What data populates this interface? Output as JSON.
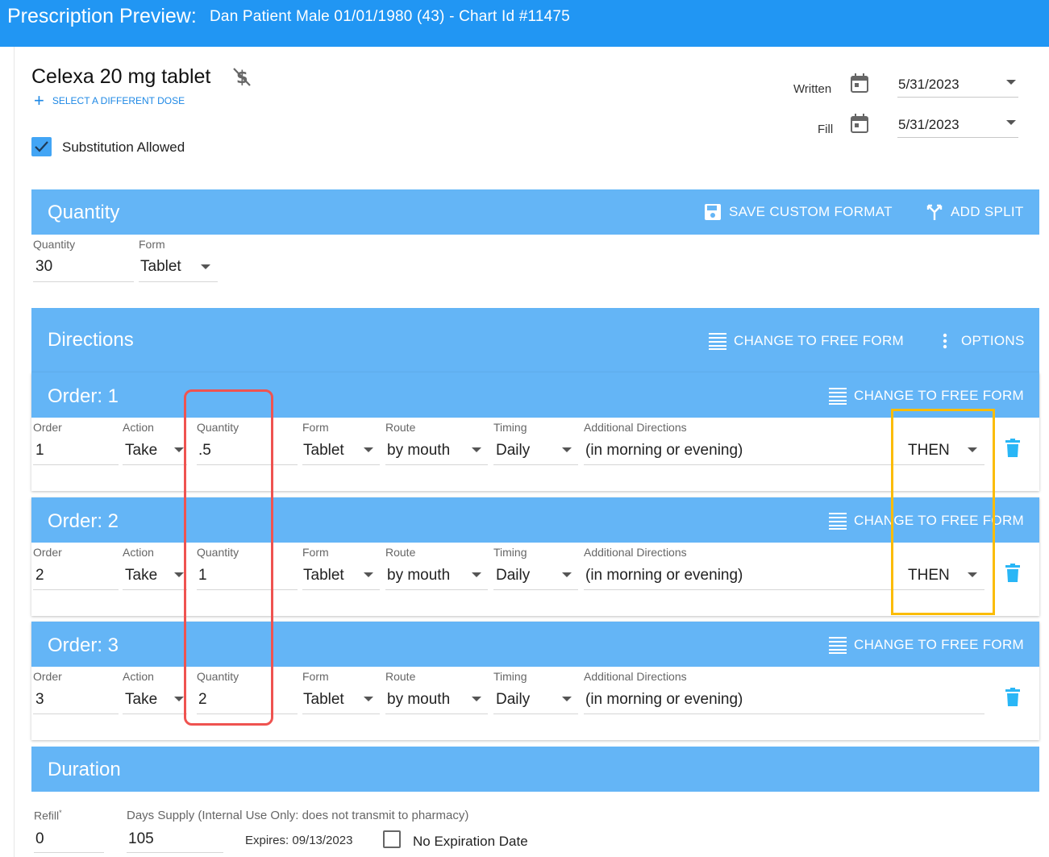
{
  "header": {
    "title": "Prescription Preview:",
    "patient": "Dan Patient Male 01/01/1980 (43) - Chart Id #11475"
  },
  "drug": {
    "name": "Celexa 20 mg tablet",
    "select_dose_label": "SELECT A DIFFERENT DOSE",
    "substitution_label": "Substitution Allowed",
    "substitution_checked": true
  },
  "dates": {
    "written_label": "Written",
    "written_value": "5/31/2023",
    "fill_label": "Fill",
    "fill_value": "5/31/2023"
  },
  "quantity_section": {
    "title": "Quantity",
    "save_format_label": "SAVE CUSTOM FORMAT",
    "add_split_label": "ADD SPLIT",
    "quantity_label": "Quantity",
    "quantity_value": "30",
    "form_label": "Form",
    "form_value": "Tablet"
  },
  "directions": {
    "title": "Directions",
    "free_form_label": "CHANGE TO FREE FORM",
    "options_label": "OPTIONS",
    "labels": {
      "order": "Order",
      "action": "Action",
      "quantity": "Quantity",
      "form": "Form",
      "route": "Route",
      "timing": "Timing",
      "additional": "Additional Directions"
    },
    "orders": [
      {
        "title": "Order: 1",
        "free_form_label": "CHANGE TO FREE FORM",
        "order": "1",
        "action": "Take",
        "quantity": ".5",
        "form": "Tablet",
        "route": "by mouth",
        "timing": "Daily",
        "additional": "(in morning or evening)",
        "connector": "THEN"
      },
      {
        "title": "Order: 2",
        "free_form_label": "CHANGE TO FREE FORM",
        "order": "2",
        "action": "Take",
        "quantity": "1",
        "form": "Tablet",
        "route": "by mouth",
        "timing": "Daily",
        "additional": "(in morning or evening)",
        "connector": "THEN"
      },
      {
        "title": "Order: 3",
        "free_form_label": "CHANGE TO FREE FORM",
        "order": "3",
        "action": "Take",
        "quantity": "2",
        "form": "Tablet",
        "route": "by mouth",
        "timing": "Daily",
        "additional": "(in morning or evening)",
        "connector": ""
      }
    ]
  },
  "duration": {
    "title": "Duration",
    "refill_label": "Refill",
    "refill_required_mark": "*",
    "refill_value": "0",
    "days_supply_label": "Days Supply (Internal Use Only: does not transmit to pharmacy)",
    "days_supply_value": "105",
    "expires_text": "Expires: 09/13/2023",
    "no_expiration_label": "No Expiration Date",
    "no_expiration_checked": false
  },
  "colors": {
    "header_blue": "#2196f3",
    "section_blue": "#64b5f6",
    "link_blue": "#1e88e5",
    "trash_blue": "#29b6f6",
    "highlight_red": "#ef5350",
    "highlight_yellow": "#fbbc05"
  },
  "icons": [
    "money-off-icon",
    "plus-icon",
    "check-icon",
    "calendar-icon",
    "caret-down-icon",
    "save-icon",
    "split-icon",
    "list-icon",
    "more-vert-icon",
    "trash-icon"
  ]
}
